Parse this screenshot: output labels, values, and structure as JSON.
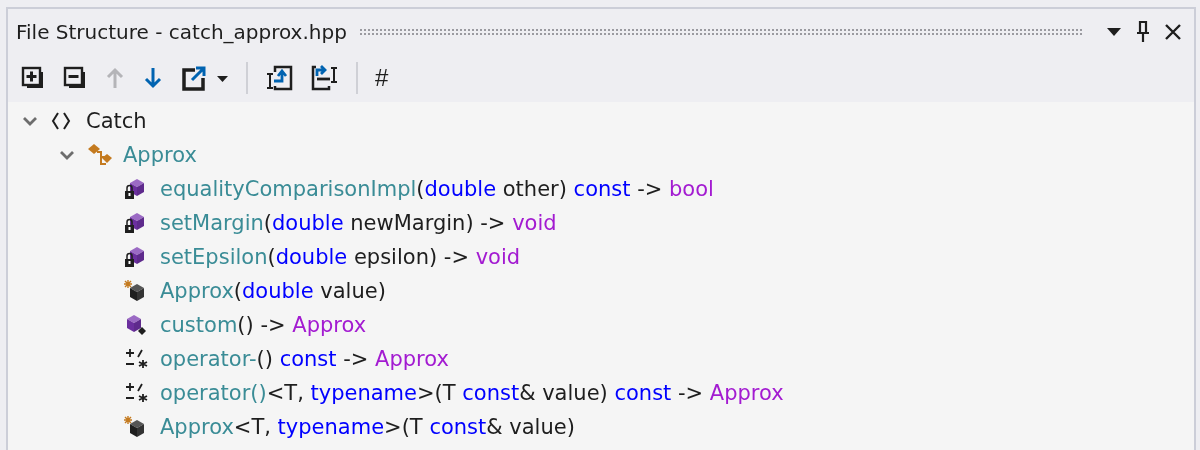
{
  "window": {
    "title": "File Structure - catch_approx.hpp"
  },
  "title_buttons": [
    {
      "kind": "menu"
    },
    {
      "kind": "pin"
    },
    {
      "kind": "close"
    }
  ],
  "toolbar": [
    {
      "kind": "expand-all",
      "disabled": false
    },
    {
      "kind": "collapse-all",
      "disabled": false
    },
    {
      "kind": "up",
      "disabled": true
    },
    {
      "kind": "down",
      "disabled": false
    },
    {
      "kind": "navigate",
      "disabled": false
    },
    {
      "kind": "separator"
    },
    {
      "kind": "track-to",
      "disabled": false
    },
    {
      "kind": "track-from",
      "disabled": false
    },
    {
      "kind": "separator"
    },
    {
      "kind": "text",
      "label": "#",
      "disabled": false
    }
  ],
  "tree": [
    {
      "kind": "namespace",
      "expanded": true,
      "label": [
        {
          "kind": "plain",
          "text": "Catch"
        }
      ],
      "children": [
        {
          "kind": "class",
          "expanded": true,
          "label": [
            {
              "kind": "name",
              "text": "Approx"
            }
          ],
          "children": [
            {
              "kind": "method-private",
              "label": [
                {
                  "kind": "name",
                  "text": "equalityComparisonImpl"
                },
                {
                  "kind": "plain",
                  "text": "("
                },
                {
                  "kind": "keyword",
                  "text": "double"
                },
                {
                  "kind": "plain",
                  "text": " other) "
                },
                {
                  "kind": "keyword",
                  "text": "const"
                },
                {
                  "kind": "plain",
                  "text": " -> "
                },
                {
                  "kind": "type",
                  "text": "bool"
                }
              ]
            },
            {
              "kind": "method-private",
              "label": [
                {
                  "kind": "name",
                  "text": "setMargin"
                },
                {
                  "kind": "plain",
                  "text": "("
                },
                {
                  "kind": "keyword",
                  "text": "double"
                },
                {
                  "kind": "plain",
                  "text": " newMargin) -> "
                },
                {
                  "kind": "type",
                  "text": "void"
                }
              ]
            },
            {
              "kind": "method-private",
              "label": [
                {
                  "kind": "name",
                  "text": "setEpsilon"
                },
                {
                  "kind": "plain",
                  "text": "("
                },
                {
                  "kind": "keyword",
                  "text": "double"
                },
                {
                  "kind": "plain",
                  "text": " epsilon) -> "
                },
                {
                  "kind": "type",
                  "text": "void"
                }
              ]
            },
            {
              "kind": "constructor",
              "label": [
                {
                  "kind": "name",
                  "text": "Approx"
                },
                {
                  "kind": "plain",
                  "text": "("
                },
                {
                  "kind": "keyword",
                  "text": "double"
                },
                {
                  "kind": "plain",
                  "text": " value)"
                }
              ]
            },
            {
              "kind": "method-static",
              "label": [
                {
                  "kind": "name",
                  "text": "custom"
                },
                {
                  "kind": "plain",
                  "text": "() -> "
                },
                {
                  "kind": "type",
                  "text": "Approx"
                }
              ]
            },
            {
              "kind": "operator",
              "label": [
                {
                  "kind": "name",
                  "text": "operator-"
                },
                {
                  "kind": "plain",
                  "text": "() "
                },
                {
                  "kind": "keyword",
                  "text": "const"
                },
                {
                  "kind": "plain",
                  "text": " -> "
                },
                {
                  "kind": "type",
                  "text": "Approx"
                }
              ]
            },
            {
              "kind": "operator",
              "label": [
                {
                  "kind": "name",
                  "text": "operator()"
                },
                {
                  "kind": "plain",
                  "text": "<T, "
                },
                {
                  "kind": "keyword",
                  "text": "typename"
                },
                {
                  "kind": "plain",
                  "text": ">(T "
                },
                {
                  "kind": "keyword",
                  "text": "const"
                },
                {
                  "kind": "plain",
                  "text": "& value) "
                },
                {
                  "kind": "keyword",
                  "text": "const"
                },
                {
                  "kind": "plain",
                  "text": " -> "
                },
                {
                  "kind": "type",
                  "text": "Approx"
                }
              ]
            },
            {
              "kind": "constructor",
              "label": [
                {
                  "kind": "name",
                  "text": "Approx"
                },
                {
                  "kind": "plain",
                  "text": "<T, "
                },
                {
                  "kind": "keyword",
                  "text": "typename"
                },
                {
                  "kind": "plain",
                  "text": ">(T "
                },
                {
                  "kind": "keyword",
                  "text": "const"
                },
                {
                  "kind": "plain",
                  "text": "& value)"
                }
              ]
            }
          ]
        }
      ]
    }
  ]
}
